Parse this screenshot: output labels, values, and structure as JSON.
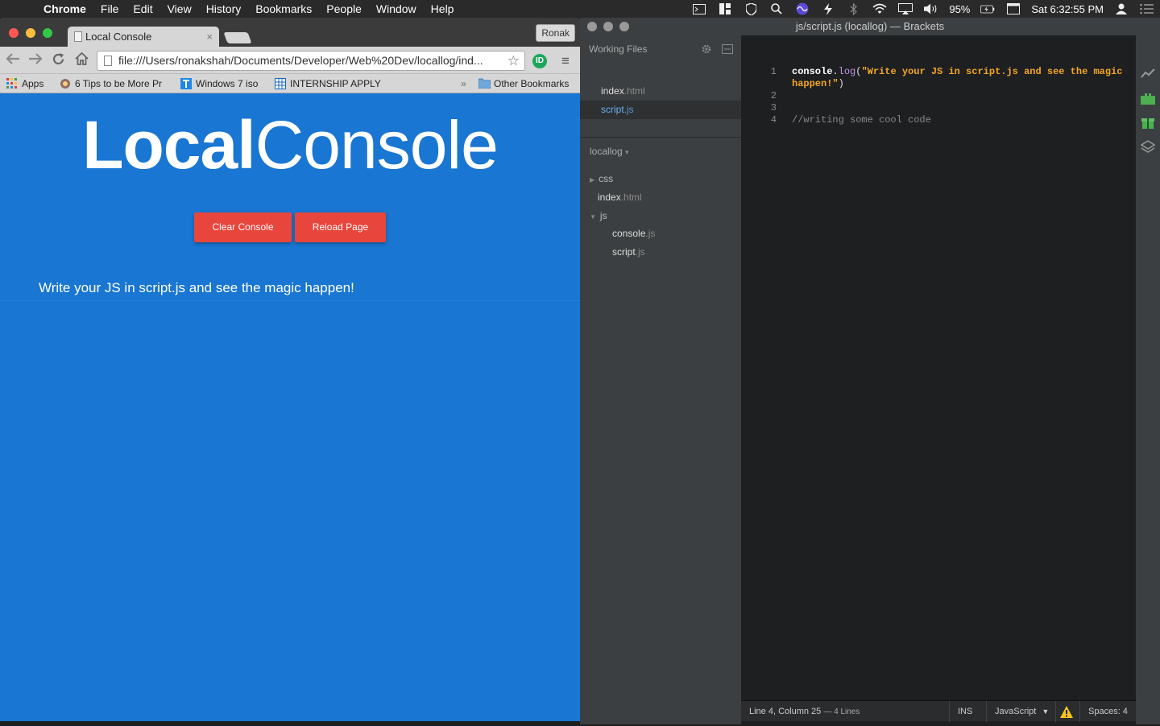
{
  "menubar": {
    "apple_glyph": "",
    "app_name": "Chrome",
    "items": [
      "File",
      "Edit",
      "View",
      "History",
      "Bookmarks",
      "People",
      "Window",
      "Help"
    ],
    "battery": "95%",
    "clock": "Sat 6:32:55 PM"
  },
  "chrome": {
    "tab_title": "Local Console",
    "tab_close": "×",
    "profile": "Ronak",
    "url": "file:///Users/ronakshah/Documents/Developer/Web%20Dev/locallog/ind...",
    "star": "☆",
    "ext_label": "ID",
    "menu_glyph": "≡",
    "bookmarks": {
      "apps": "Apps",
      "b1": "6 Tips to be More Pr",
      "b2": "Windows 7 iso",
      "b3": "INTERNSHIP APPLY",
      "overflow": "»",
      "other": "Other Bookmarks"
    }
  },
  "page": {
    "title_bold": "Local",
    "title_light": "Console",
    "clear_button": "Clear Console",
    "reload_button": "Reload Page",
    "console_output": "Write your JS in script.js and see the magic happen!"
  },
  "brackets": {
    "window_title": "js/script.js (locallog) — Brackets",
    "working_files_header": "Working Files",
    "working_files": [
      {
        "name": "index",
        "ext": ".html"
      },
      {
        "name": "script",
        "ext": ".js"
      }
    ],
    "project_name": "locallog",
    "project_caret": "▾",
    "tree": {
      "css": "css",
      "index_name": "index",
      "index_ext": ".html",
      "js": "js",
      "console_name": "console",
      "console_ext": ".js",
      "script_name": "script",
      "script_ext": ".js"
    },
    "code": {
      "line_numbers": [
        "1",
        "2",
        "3",
        "4"
      ],
      "l1_obj": "console",
      "l1_dot": ".",
      "l1_fn": "log",
      "l1_paren_open": "(",
      "l1_string_a": "\"Write your JS in script.js and see the magic",
      "l1_string_b": "happen!\"",
      "l1_paren_close": ")",
      "l4_comment": "//writing some cool code"
    },
    "status": {
      "cursor": "Line 4, Column 25",
      "lines": "— 4 Lines",
      "mode": "INS",
      "language": "JavaScript",
      "spaces": "Spaces: 4"
    }
  },
  "colors": {
    "page_bg": "#1976d2",
    "button_red": "#e8453c",
    "code_string": "#f5a623",
    "code_fn": "#c792ea",
    "code_comment": "#8a8a8a"
  }
}
